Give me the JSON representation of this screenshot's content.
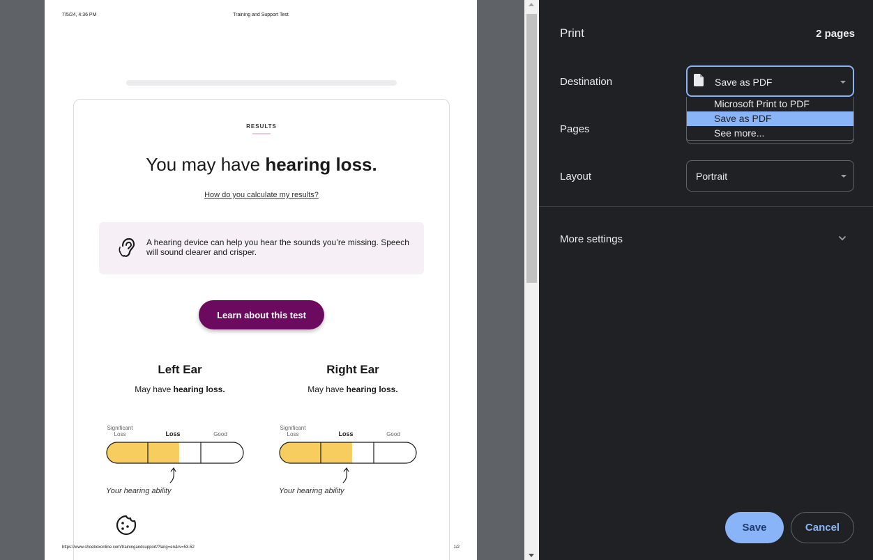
{
  "preview": {
    "header": {
      "date": "7/5/24, 4:36 PM",
      "title": "Training and Support Test"
    },
    "results_label": "RESULTS",
    "headline_prefix": "You may have ",
    "headline_bold": "hearing loss.",
    "calc_link": "How do you calculate my results?",
    "info_text": "A hearing device can help you hear the sounds you’re missing. Speech will sound clearer and crisper.",
    "learn_button": "Learn about this test",
    "ears": [
      {
        "title": "Left Ear",
        "sub_prefix": "May have ",
        "sub_bold": "hearing loss.",
        "level": "Loss",
        "ability_fraction": 0.53
      },
      {
        "title": "Right Ear",
        "sub_prefix": "May have ",
        "sub_bold": "hearing loss.",
        "level": "Loss",
        "ability_fraction": 0.53
      }
    ],
    "scale": {
      "significant": "Significant Loss",
      "loss": "Loss",
      "good": "Good"
    },
    "ability_label": "Your hearing ability",
    "footer": {
      "url": "https://www.shoeboxonline.com/trainingandsupport/?lang=en&rv=53-52",
      "page": "1/2"
    },
    "colors": {
      "accent": "#6b0a5e",
      "gauge_fill": "#f8cd5f",
      "info_bg": "#f6f0f6"
    }
  },
  "panel": {
    "title": "Print",
    "page_count": "2 pages",
    "destination": {
      "label": "Destination",
      "value": "Save as PDF",
      "options": [
        "Microsoft Print to PDF",
        "Save as PDF",
        "See more..."
      ],
      "selected_index": 1
    },
    "pages": {
      "label": "Pages"
    },
    "layout": {
      "label": "Layout",
      "value": "Portrait"
    },
    "more_settings": "More settings",
    "save": "Save",
    "cancel": "Cancel",
    "colors": {
      "accent": "#8ab4f8",
      "bg": "#202124"
    }
  }
}
